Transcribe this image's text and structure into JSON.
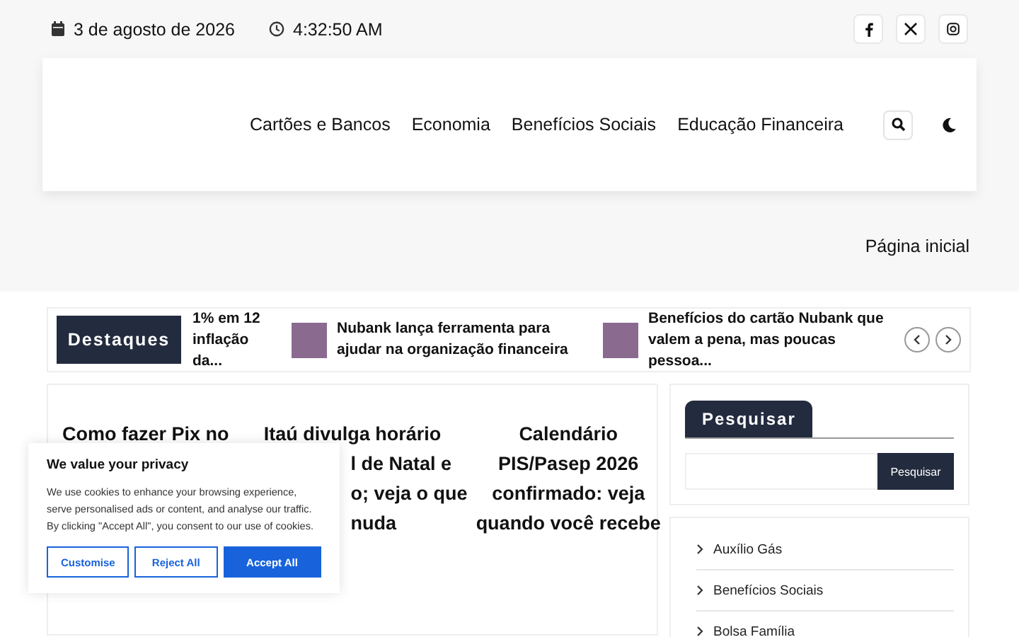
{
  "topbar": {
    "date": "3 de agosto de 2026",
    "time": "4:32:50 AM",
    "social": [
      {
        "kind": "facebook"
      },
      {
        "kind": "x"
      },
      {
        "kind": "instagram"
      }
    ]
  },
  "nav": {
    "items": [
      {
        "label": "Cartões e Bancos"
      },
      {
        "label": "Economia"
      },
      {
        "label": "Benefícios Sociais"
      },
      {
        "label": "Educação Financeira"
      }
    ]
  },
  "breadcrumb": "Página inicial",
  "ticker": {
    "label": "Destaques",
    "items": [
      {
        "text": "1% em 12 inflação da...",
        "thumb": false
      },
      {
        "text": "Nubank lança ferramenta para ajudar na organização financeira",
        "thumb": true
      },
      {
        "text": "Benefícios do cartão Nubank que valem a pena, mas poucas pessoa...",
        "thumb": true
      }
    ]
  },
  "articles": [
    {
      "lines": [
        "Como fazer Pix no"
      ]
    },
    {
      "lines": [
        "Itaú divulga horário",
        "l de Natal e",
        "o; veja o que",
        "nuda"
      ]
    },
    {
      "lines": [
        "Calendário",
        "PIS/Pasep 2026",
        "confirmado: veja",
        "quando você recebe"
      ]
    }
  ],
  "search_widget": {
    "title": "Pesquisar",
    "button": "Pesquisar"
  },
  "categories": [
    "Auxílio Gás",
    "Benefícios Sociais",
    "Bolsa Família"
  ],
  "cookie": {
    "title": "We value your privacy",
    "text": "We use cookies to enhance your browsing experience, serve personalised ads or content, and analyse our traffic. By clicking \"Accept All\", you consent to our use of cookies.",
    "buttons": [
      {
        "label": "Customise",
        "kind": "outline"
      },
      {
        "label": "Reject All",
        "kind": "outline"
      },
      {
        "label": "Accept All",
        "kind": "primary"
      }
    ]
  }
}
